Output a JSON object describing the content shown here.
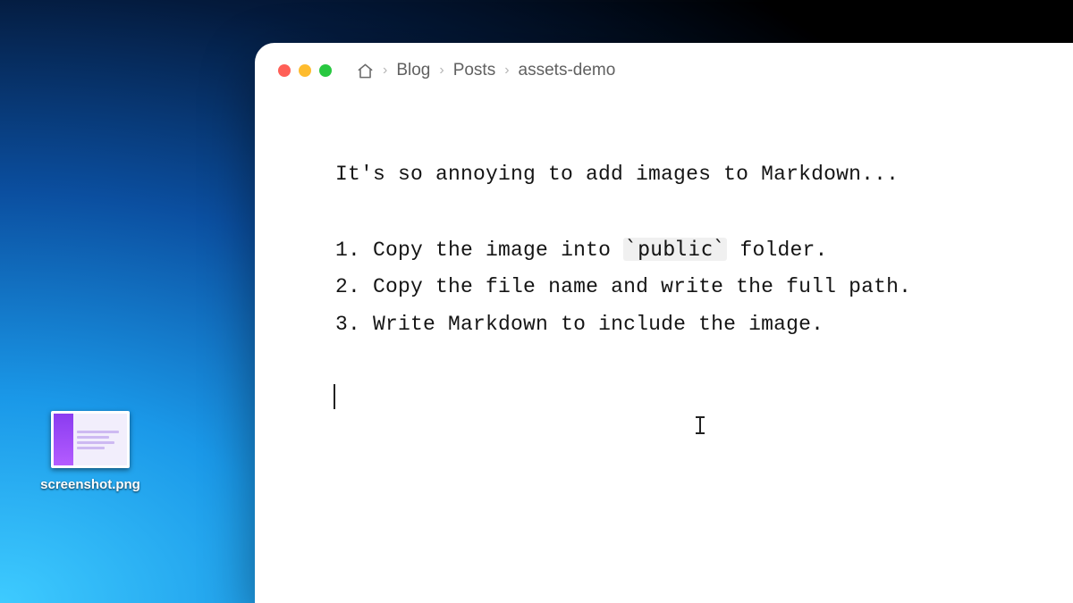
{
  "desktop": {
    "file": {
      "label": "screenshot.png"
    }
  },
  "editor": {
    "breadcrumb": {
      "items": [
        "Blog",
        "Posts",
        "assets-demo"
      ]
    },
    "content": {
      "intro": "It's so annoying to add images to Markdown...",
      "steps": [
        {
          "pre": "Copy the image into ",
          "code": "`public`",
          "post": " folder."
        },
        {
          "pre": "Copy the file name and write the full path.",
          "code": "",
          "post": ""
        },
        {
          "pre": "Write Markdown to include the image.",
          "code": "",
          "post": ""
        }
      ]
    }
  }
}
